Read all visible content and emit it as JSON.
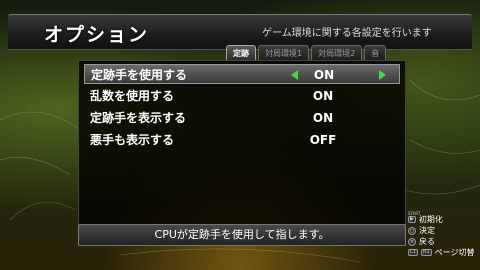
{
  "screen": {
    "title": "オプション",
    "subtitle": "ゲーム環境に関する各設定を行います"
  },
  "tabs": [
    {
      "label": "定跡",
      "active": true
    },
    {
      "label": "対局環境1",
      "active": false
    },
    {
      "label": "対局環境2",
      "active": false
    },
    {
      "label": "音",
      "active": false
    }
  ],
  "options": [
    {
      "label": "定跡手を使用する",
      "value": "ON",
      "selected": true
    },
    {
      "label": "乱数を使用する",
      "value": "ON",
      "selected": false
    },
    {
      "label": "定跡手を表示する",
      "value": "ON",
      "selected": false
    },
    {
      "label": "悪手も表示する",
      "value": "OFF",
      "selected": false
    }
  ],
  "help_text": "CPUが定跡手を使用して指します。",
  "controls": {
    "start_label": "START",
    "reset_label": "初期化",
    "confirm_label": "決定",
    "back_label": "戻る",
    "page_label": "ページ切替",
    "l1": "L1",
    "r1": "R1"
  },
  "colors": {
    "arrow": "#4ad64a",
    "selected_row": "#5a5a5a"
  }
}
